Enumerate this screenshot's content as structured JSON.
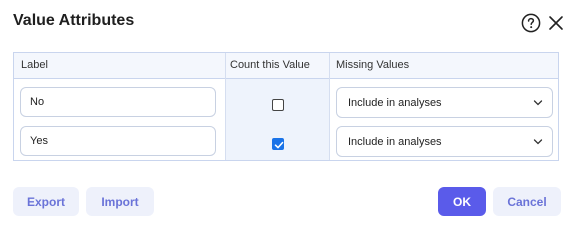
{
  "dialog": {
    "title": "Value Attributes",
    "help_icon": "question-circle-icon",
    "close_icon": "close-icon"
  },
  "table": {
    "columns": {
      "label": "Label",
      "count": "Count this Value",
      "missing": "Missing Values"
    },
    "rows": [
      {
        "label": "No",
        "count_checked": false,
        "missing": "Include in analyses"
      },
      {
        "label": "Yes",
        "count_checked": true,
        "missing": "Include in analyses"
      }
    ]
  },
  "footer": {
    "export_label": "Export",
    "import_label": "Import",
    "ok_label": "OK",
    "cancel_label": "Cancel"
  },
  "colors": {
    "primary": "#5a5bea",
    "checkbox": "#1a73e8",
    "secondary_button_bg": "#eef1fb",
    "secondary_button_text": "#6a73d8"
  }
}
